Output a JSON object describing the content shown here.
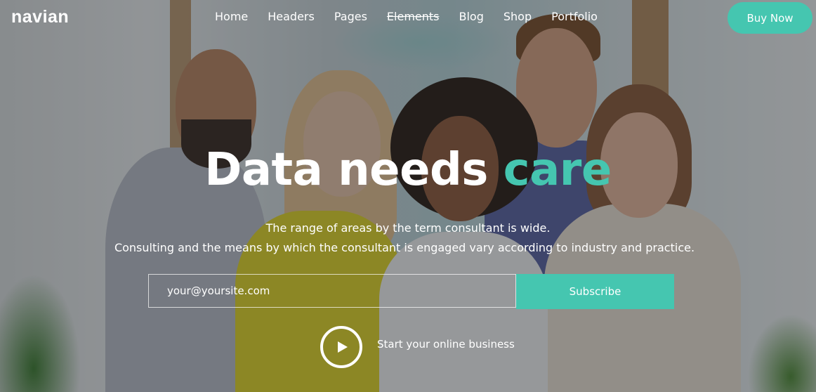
{
  "header": {
    "logo": "navian",
    "nav": [
      "Home",
      "Headers",
      "Pages",
      "Elements",
      "Blog",
      "Shop",
      "Portfolio"
    ],
    "cta": "Buy Now"
  },
  "hero": {
    "headline": "Data needs",
    "headline_accent": "care",
    "sub1": "The range of areas by the term consultant is wide.",
    "sub2": "Consulting and the means by which the consultant is engaged vary according to industry and practice.",
    "email_placeholder": "your@yoursite.com",
    "subscribe_label": "Subscribe",
    "video_label": "Start your online business"
  },
  "colors": {
    "accent": "#45c6b0",
    "text": "#ffffff"
  },
  "icons": [
    "play-icon"
  ]
}
